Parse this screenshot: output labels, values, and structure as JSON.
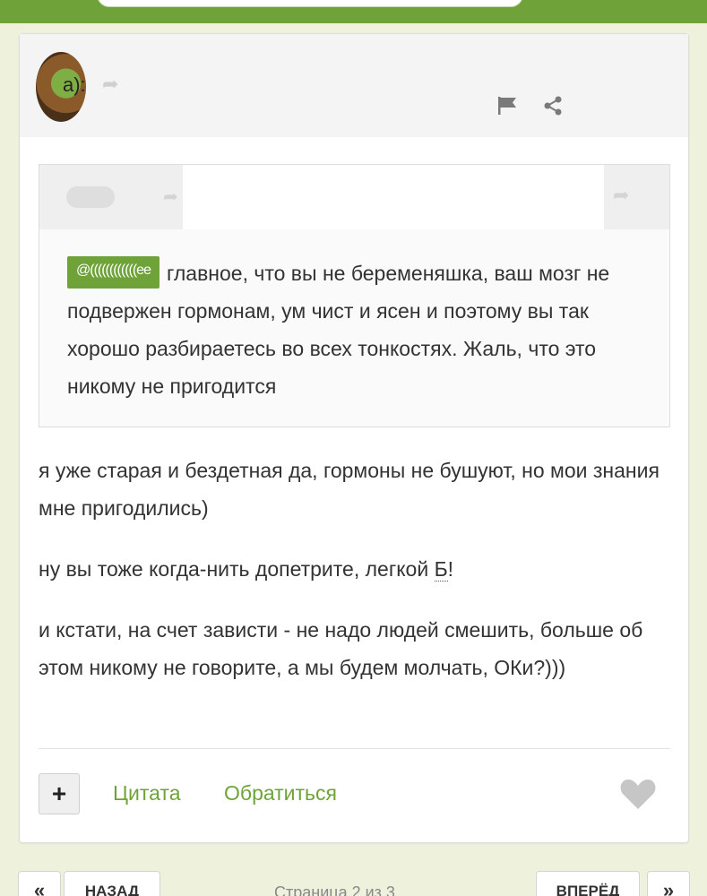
{
  "header": {
    "search_placeholder": ""
  },
  "post": {
    "author_suffix": "a):",
    "quote": {
      "mention": "@((((((((((((ee",
      "text": "главное, что вы не беременяшка, ваш мозг не подвержен гормонам, ум чист и ясен и поэтому вы так хорошо разбираетесь во всех тонкостях. Жаль, что это никому не пригодится"
    },
    "paragraphs": {
      "p1": "я уже старая и бездетная да, гормоны не бушуют, но мои знания мне пригодились)",
      "p2_start": "ну вы тоже когда-нить допетрите, легкой ",
      "p2_emoji": "Б",
      "p2_end": "!",
      "p3": "и кстати, на счет зависти - не надо людей смешить, больше об этом никому не говорите, а мы будем молчать, ОКи?)))"
    },
    "actions": {
      "plus_label": "+",
      "quote_label": "Цитата",
      "reply_label": "Обратиться"
    }
  },
  "pagination": {
    "first_label": "«",
    "prev_label": "НАЗАД",
    "info": "Страница 2 из 3",
    "next_label": "ВПЕРЁД",
    "last_label": "»"
  },
  "colors": {
    "accent": "#6fa33a",
    "background": "#eef2dc",
    "card": "#ffffff"
  },
  "icons": [
    "flag-icon",
    "share-icon",
    "heart-icon",
    "reply-arrow-icon"
  ]
}
